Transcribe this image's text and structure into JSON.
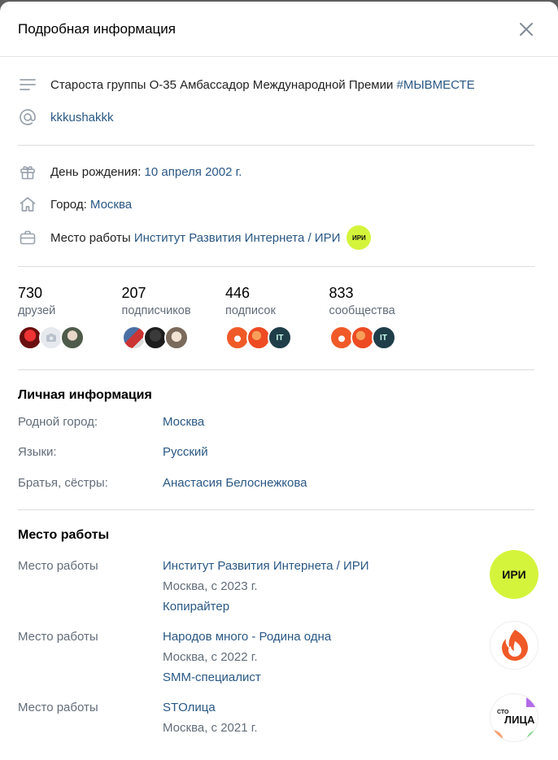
{
  "header": {
    "title": "Подробная информация"
  },
  "status": {
    "text": "Староста группы О-35 Амбассадор Международной Премии ",
    "hashtag": "#МЫВМЕСТЕ"
  },
  "nickname": "kkkushakkk",
  "birthday": {
    "label": "День рождения:",
    "value": "10 апреля 2002 г."
  },
  "city": {
    "label": "Город:",
    "value": "Москва"
  },
  "job": {
    "label": "Место работы",
    "value": "Институт Развития Интернета / ИРИ",
    "badge": "ИРИ"
  },
  "stats": [
    {
      "num": "730",
      "label": "друзей"
    },
    {
      "num": "207",
      "label": "подписчиков"
    },
    {
      "num": "446",
      "label": "подписок"
    },
    {
      "num": "833",
      "label": "сообщества"
    }
  ],
  "personal": {
    "title": "Личная информация",
    "rows": [
      {
        "key": "Родной город:",
        "value": "Москва"
      },
      {
        "key": "Языки:",
        "value": "Русский"
      },
      {
        "key": "Братья, сёстры:",
        "value": "Анастасия Белоснежкова"
      }
    ]
  },
  "work": {
    "title": "Место работы",
    "items": [
      {
        "key": "Место работы",
        "org": "Институт Развития Интернета / ИРИ",
        "place": "Москва, с 2023 г.",
        "position": "Копирайтер"
      },
      {
        "key": "Место работы",
        "org": "Народов много - Родина одна",
        "place": "Москва, с 2022 г.",
        "position": "SMM-специалист"
      },
      {
        "key": "Место работы",
        "org": "STОлица",
        "place": "Москва, с 2021 г.",
        "position": ""
      }
    ],
    "logo_texts": [
      "ИРИ",
      "СТО",
      "ЛИЦА"
    ]
  },
  "colors": {
    "link": "#2a5885",
    "muted": "#626d7a",
    "iri": "#d4f43c",
    "phoenix": "#f05a28"
  }
}
